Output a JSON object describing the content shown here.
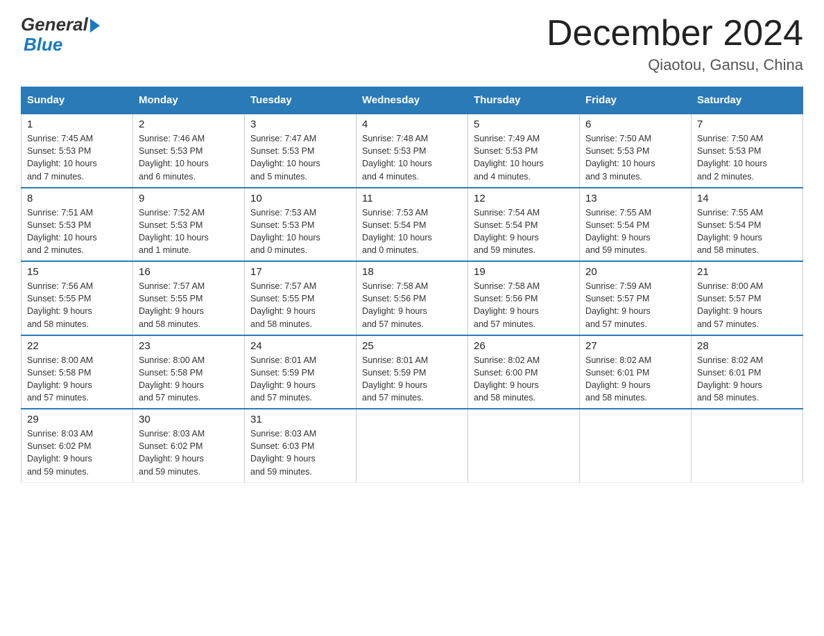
{
  "header": {
    "logo_general": "General",
    "logo_blue": "Blue",
    "title": "December 2024",
    "subtitle": "Qiaotou, Gansu, China"
  },
  "days_of_week": [
    "Sunday",
    "Monday",
    "Tuesday",
    "Wednesday",
    "Thursday",
    "Friday",
    "Saturday"
  ],
  "weeks": [
    [
      {
        "day": "1",
        "sunrise": "7:45 AM",
        "sunset": "5:53 PM",
        "daylight": "10 hours and 7 minutes."
      },
      {
        "day": "2",
        "sunrise": "7:46 AM",
        "sunset": "5:53 PM",
        "daylight": "10 hours and 6 minutes."
      },
      {
        "day": "3",
        "sunrise": "7:47 AM",
        "sunset": "5:53 PM",
        "daylight": "10 hours and 5 minutes."
      },
      {
        "day": "4",
        "sunrise": "7:48 AM",
        "sunset": "5:53 PM",
        "daylight": "10 hours and 4 minutes."
      },
      {
        "day": "5",
        "sunrise": "7:49 AM",
        "sunset": "5:53 PM",
        "daylight": "10 hours and 4 minutes."
      },
      {
        "day": "6",
        "sunrise": "7:50 AM",
        "sunset": "5:53 PM",
        "daylight": "10 hours and 3 minutes."
      },
      {
        "day": "7",
        "sunrise": "7:50 AM",
        "sunset": "5:53 PM",
        "daylight": "10 hours and 2 minutes."
      }
    ],
    [
      {
        "day": "8",
        "sunrise": "7:51 AM",
        "sunset": "5:53 PM",
        "daylight": "10 hours and 2 minutes."
      },
      {
        "day": "9",
        "sunrise": "7:52 AM",
        "sunset": "5:53 PM",
        "daylight": "10 hours and 1 minute."
      },
      {
        "day": "10",
        "sunrise": "7:53 AM",
        "sunset": "5:53 PM",
        "daylight": "10 hours and 0 minutes."
      },
      {
        "day": "11",
        "sunrise": "7:53 AM",
        "sunset": "5:54 PM",
        "daylight": "10 hours and 0 minutes."
      },
      {
        "day": "12",
        "sunrise": "7:54 AM",
        "sunset": "5:54 PM",
        "daylight": "9 hours and 59 minutes."
      },
      {
        "day": "13",
        "sunrise": "7:55 AM",
        "sunset": "5:54 PM",
        "daylight": "9 hours and 59 minutes."
      },
      {
        "day": "14",
        "sunrise": "7:55 AM",
        "sunset": "5:54 PM",
        "daylight": "9 hours and 58 minutes."
      }
    ],
    [
      {
        "day": "15",
        "sunrise": "7:56 AM",
        "sunset": "5:55 PM",
        "daylight": "9 hours and 58 minutes."
      },
      {
        "day": "16",
        "sunrise": "7:57 AM",
        "sunset": "5:55 PM",
        "daylight": "9 hours and 58 minutes."
      },
      {
        "day": "17",
        "sunrise": "7:57 AM",
        "sunset": "5:55 PM",
        "daylight": "9 hours and 58 minutes."
      },
      {
        "day": "18",
        "sunrise": "7:58 AM",
        "sunset": "5:56 PM",
        "daylight": "9 hours and 57 minutes."
      },
      {
        "day": "19",
        "sunrise": "7:58 AM",
        "sunset": "5:56 PM",
        "daylight": "9 hours and 57 minutes."
      },
      {
        "day": "20",
        "sunrise": "7:59 AM",
        "sunset": "5:57 PM",
        "daylight": "9 hours and 57 minutes."
      },
      {
        "day": "21",
        "sunrise": "8:00 AM",
        "sunset": "5:57 PM",
        "daylight": "9 hours and 57 minutes."
      }
    ],
    [
      {
        "day": "22",
        "sunrise": "8:00 AM",
        "sunset": "5:58 PM",
        "daylight": "9 hours and 57 minutes."
      },
      {
        "day": "23",
        "sunrise": "8:00 AM",
        "sunset": "5:58 PM",
        "daylight": "9 hours and 57 minutes."
      },
      {
        "day": "24",
        "sunrise": "8:01 AM",
        "sunset": "5:59 PM",
        "daylight": "9 hours and 57 minutes."
      },
      {
        "day": "25",
        "sunrise": "8:01 AM",
        "sunset": "5:59 PM",
        "daylight": "9 hours and 57 minutes."
      },
      {
        "day": "26",
        "sunrise": "8:02 AM",
        "sunset": "6:00 PM",
        "daylight": "9 hours and 58 minutes."
      },
      {
        "day": "27",
        "sunrise": "8:02 AM",
        "sunset": "6:01 PM",
        "daylight": "9 hours and 58 minutes."
      },
      {
        "day": "28",
        "sunrise": "8:02 AM",
        "sunset": "6:01 PM",
        "daylight": "9 hours and 58 minutes."
      }
    ],
    [
      {
        "day": "29",
        "sunrise": "8:03 AM",
        "sunset": "6:02 PM",
        "daylight": "9 hours and 59 minutes."
      },
      {
        "day": "30",
        "sunrise": "8:03 AM",
        "sunset": "6:02 PM",
        "daylight": "9 hours and 59 minutes."
      },
      {
        "day": "31",
        "sunrise": "8:03 AM",
        "sunset": "6:03 PM",
        "daylight": "9 hours and 59 minutes."
      },
      null,
      null,
      null,
      null
    ]
  ],
  "labels": {
    "sunrise": "Sunrise:",
    "sunset": "Sunset:",
    "daylight": "Daylight:"
  }
}
